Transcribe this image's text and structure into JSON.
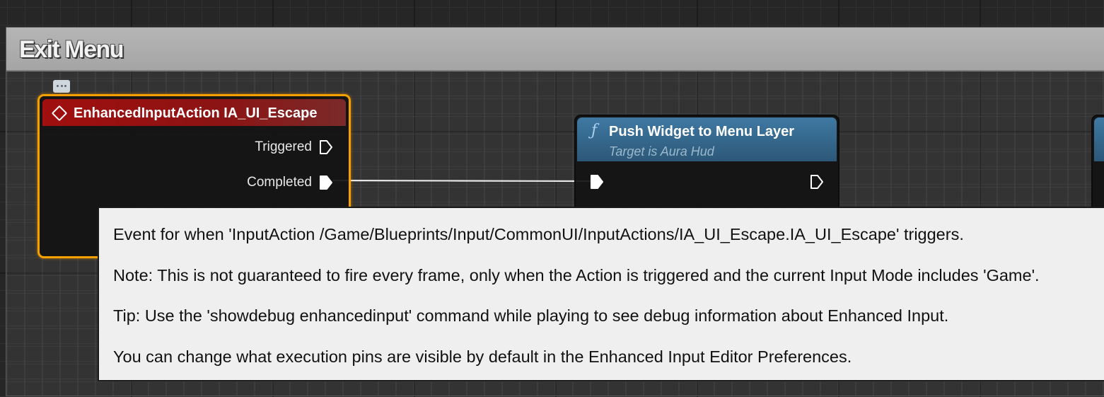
{
  "comment": {
    "title": "Exit Menu"
  },
  "event_node": {
    "title": "EnhancedInputAction IA_UI_Escape",
    "header_color": "#a10f0f",
    "selection_color": "#f5a000",
    "icon": "event-diamond-icon",
    "pins": [
      {
        "label": "Triggered",
        "connected": false
      },
      {
        "label": "Completed",
        "connected": true
      }
    ]
  },
  "function_node": {
    "icon_glyph": "ƒ",
    "title": "Push Widget to Menu Layer",
    "subtitle": "Target is Aura Hud",
    "header_color": "#3f79a3"
  },
  "tooltip": {
    "lines": [
      "Event for when 'InputAction /Game/Blueprints/Input/CommonUI/InputActions/IA_UI_Escape.IA_UI_Escape' triggers.",
      "Note: This is not guaranteed to fire every frame, only when the Action is triggered and the current Input Mode includes 'Game'.",
      "Tip: Use the 'showdebug enhancedinput' command while playing to see debug information about Enhanced Input.",
      "You can change what execution pins are visible by default in the Enhanced Input Editor Preferences."
    ]
  }
}
